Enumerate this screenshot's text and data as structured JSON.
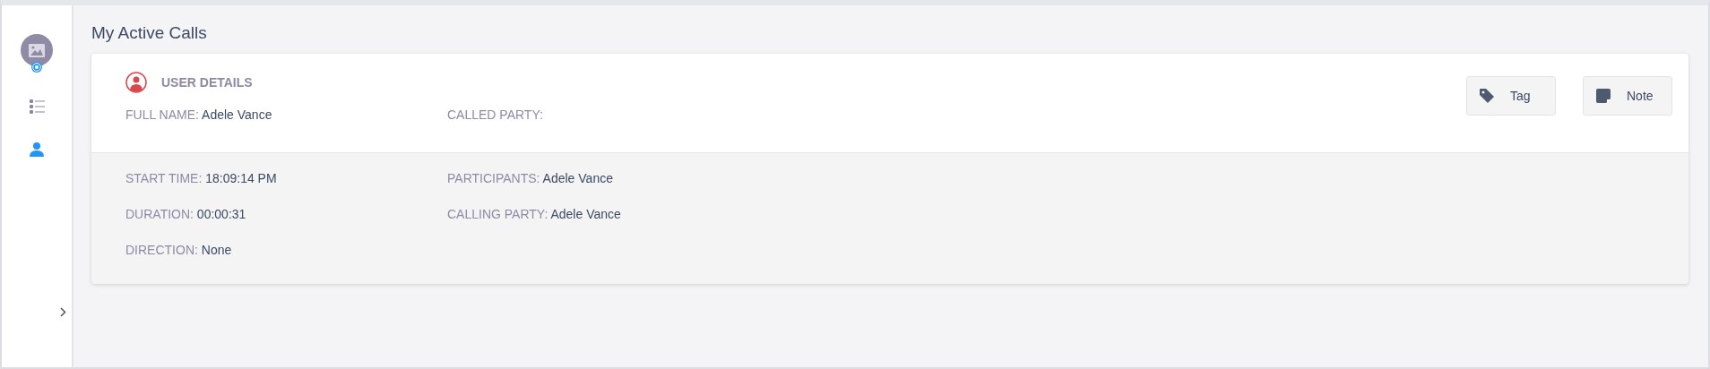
{
  "sidebar": {
    "items": [
      {
        "kind": "list",
        "selected": false
      },
      {
        "kind": "user",
        "selected": true
      }
    ]
  },
  "page_title": "My Active Calls",
  "card": {
    "section_title": "USER DETAILS",
    "header_fields": [
      {
        "label": "FULL NAME:",
        "value": "Adele Vance"
      },
      {
        "label": "CALLED PARTY:"
      }
    ],
    "buttons": [
      {
        "kind": "tag",
        "label": "Tag"
      },
      {
        "kind": "note",
        "label": "Note"
      }
    ],
    "detail_fields": [
      {
        "label": "START TIME:",
        "value": "18:09:14 PM"
      },
      {
        "label": "PARTICIPANTS:",
        "value": "Adele Vance"
      },
      {
        "label": "DURATION:",
        "value": "00:00:31"
      },
      {
        "label": "CALLING PARTY:",
        "value": "Adele Vance"
      },
      {
        "label": "DIRECTION:",
        "value": "None"
      }
    ]
  }
}
